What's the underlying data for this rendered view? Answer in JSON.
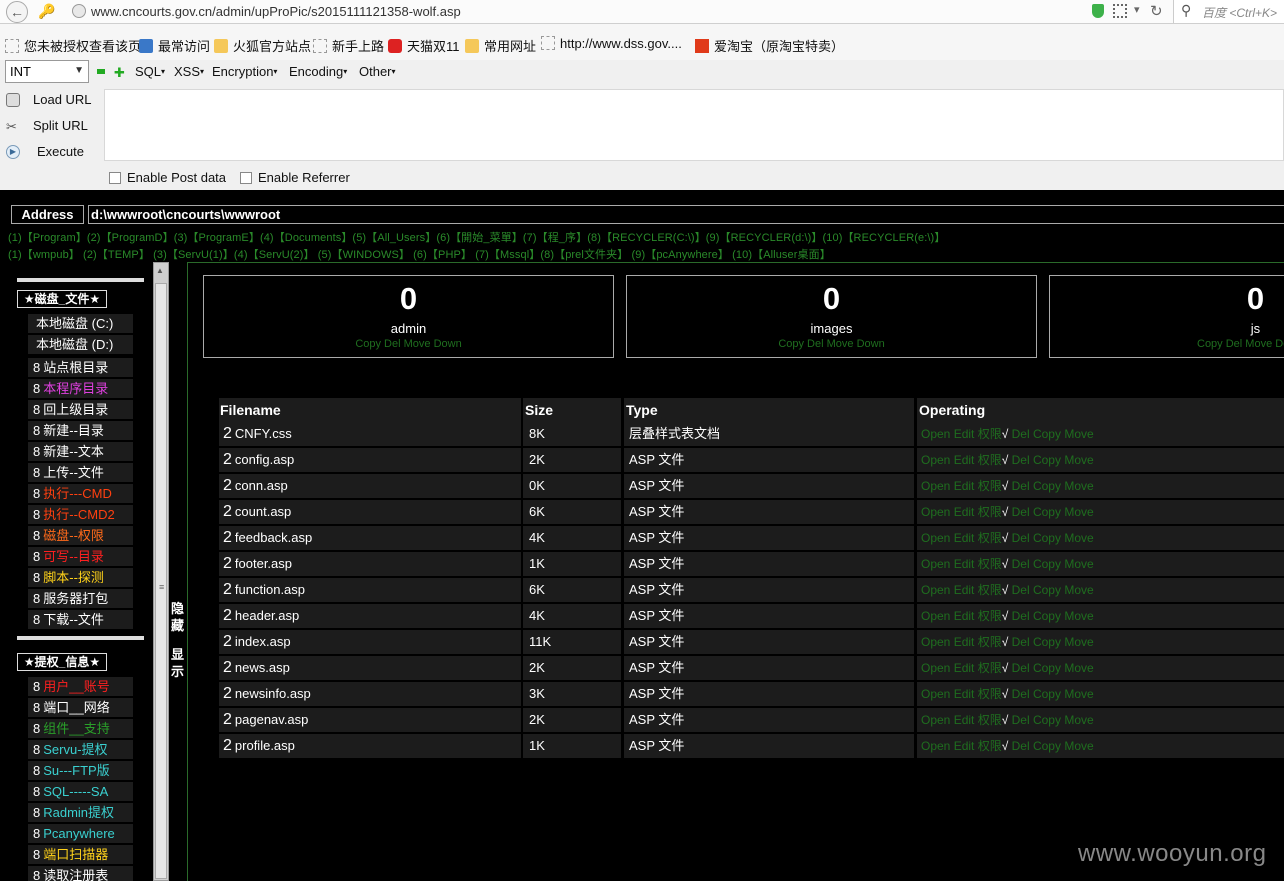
{
  "browser": {
    "url": "www.cncourts.gov.cn/admin/upProPic/s2015111121358-wolf.asp",
    "search_placeholder": "百度 <Ctrl+K>"
  },
  "bookmarks": [
    "您未被授权查看该页",
    "最常访问",
    "火狐官方站点",
    "新手上路",
    "天猫双11",
    "常用网址",
    "http://www.dss.gov....",
    "爱淘宝（原淘宝特卖）"
  ],
  "hackbar": {
    "select_value": "INT",
    "menus": [
      "SQL",
      "XSS",
      "Encryption",
      "Encoding",
      "Other"
    ],
    "actions": [
      "Load URL",
      "Split URL",
      "Execute"
    ],
    "checkboxes": [
      "Enable Post data",
      "Enable Referrer"
    ]
  },
  "shell": {
    "address_label": "Address",
    "address_value": "d:\\wwwroot\\cncourts\\wwwroot",
    "quick_line1": "(1)【Program】(2)【ProgramD】(3)【ProgramE】(4)【Documents】(5)【All_Users】(6)【開始_菜單】(7)【程_序】(8)【RECYCLER(C:\\)】(9)【RECYCLER(d:\\)】(10)【RECYCLER(e:\\)】",
    "quick_line2": "(1)【wmpub】  (2)【TEMP】    (3)【ServU(1)】(4)【ServU(2)】 (5)【WINDOWS】  (6)【PHP】      (7)【Mssql】(8)【prel文件夹】   (9)【pcAnywhere】 (10)【Alluser桌面】",
    "toggle_hide": "隐藏",
    "toggle_show": "显示"
  },
  "sidebar": {
    "section1_title": "★磁盘_文件★",
    "drives": [
      "本地磁盘 (C:)",
      "本地磁盘 (D:)"
    ],
    "items1": [
      {
        "num": "8",
        "label": "站点根目录",
        "color": "#ffffff"
      },
      {
        "num": "8",
        "label": "本程序目录",
        "color": "#e040e0"
      },
      {
        "num": "8",
        "label": "回上级目录",
        "color": "#ffffff"
      },
      {
        "num": "8",
        "label": "新建--目录",
        "color": "#ffffff"
      },
      {
        "num": "8",
        "label": "新建--文本",
        "color": "#ffffff"
      },
      {
        "num": "8",
        "label": "上传--文件",
        "color": "#ffffff"
      },
      {
        "num": "8",
        "label": "执行---CMD",
        "color": "#ff4010"
      },
      {
        "num": "8",
        "label": "执行--CMD2",
        "color": "#ff4010"
      },
      {
        "num": "8",
        "label": "磁盘--权限",
        "color": "#ff6a1a"
      },
      {
        "num": "8",
        "label": "可写--目录",
        "color": "#ff2020"
      },
      {
        "num": "8",
        "label": "脚本--探测",
        "color": "#ffd21a"
      },
      {
        "num": "8",
        "label": "服务器打包",
        "color": "#ffffff"
      },
      {
        "num": "8",
        "label": "下载--文件",
        "color": "#ffffff"
      }
    ],
    "section2_title": "★提权_信息★",
    "items2": [
      {
        "num": "8",
        "label": "用户__账号",
        "color": "#ff2020"
      },
      {
        "num": "8",
        "label": "端口__网络",
        "color": "#ffffff"
      },
      {
        "num": "8",
        "label": "组件__支持",
        "color": "#2aa02a"
      },
      {
        "num": "8",
        "label": "Servu-提权",
        "color": "#3ad0d0"
      },
      {
        "num": "8",
        "label": "Su---FTP版",
        "color": "#3ad0d0"
      },
      {
        "num": "8",
        "label": "SQL-----SA",
        "color": "#3ad0d0"
      },
      {
        "num": "8",
        "label": "Radmin提权",
        "color": "#3ad0d0"
      },
      {
        "num": "8",
        "label": "Pcanywhere",
        "color": "#3ad0d0"
      },
      {
        "num": "8",
        "label": "端口扫描器",
        "color": "#ffd21a"
      },
      {
        "num": "8",
        "label": "读取注册表",
        "color": "#ffffff"
      }
    ]
  },
  "folders": [
    {
      "count": "0",
      "name": "admin",
      "actions": "Copy Del Move Down"
    },
    {
      "count": "0",
      "name": "images",
      "actions": "Copy Del Move Down"
    },
    {
      "count": "0",
      "name": "js",
      "actions": "Copy Del Move Down"
    }
  ],
  "table": {
    "headers": [
      "Filename",
      "Size",
      "Type",
      "Operating"
    ],
    "ops_left": "Open Edit 权限",
    "ops_check": "√",
    "ops_right": " Del Copy Move",
    "rows": [
      {
        "num": "2",
        "name": "CNFY.css",
        "size": "8K",
        "type": "层叠样式表文档"
      },
      {
        "num": "2",
        "name": "config.asp",
        "size": "2K",
        "type": "ASP 文件"
      },
      {
        "num": "2",
        "name": "conn.asp",
        "size": "0K",
        "type": "ASP 文件"
      },
      {
        "num": "2",
        "name": "count.asp",
        "size": "6K",
        "type": "ASP 文件"
      },
      {
        "num": "2",
        "name": "feedback.asp",
        "size": "4K",
        "type": "ASP 文件"
      },
      {
        "num": "2",
        "name": "footer.asp",
        "size": "1K",
        "type": "ASP 文件"
      },
      {
        "num": "2",
        "name": "function.asp",
        "size": "6K",
        "type": "ASP 文件"
      },
      {
        "num": "2",
        "name": "header.asp",
        "size": "4K",
        "type": "ASP 文件"
      },
      {
        "num": "2",
        "name": "index.asp",
        "size": "11K",
        "type": "ASP 文件"
      },
      {
        "num": "2",
        "name": "news.asp",
        "size": "2K",
        "type": "ASP 文件"
      },
      {
        "num": "2",
        "name": "newsinfo.asp",
        "size": "3K",
        "type": "ASP 文件"
      },
      {
        "num": "2",
        "name": "pagenav.asp",
        "size": "2K",
        "type": "ASP 文件"
      },
      {
        "num": "2",
        "name": "profile.asp",
        "size": "1K",
        "type": "ASP 文件"
      }
    ]
  },
  "watermark": "www.wooyun.org"
}
